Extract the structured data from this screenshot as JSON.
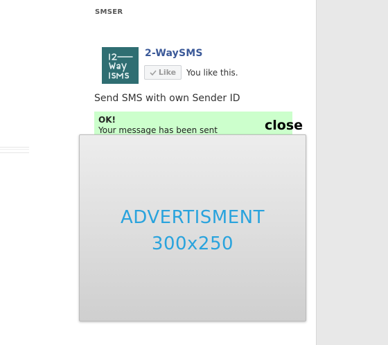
{
  "section": {
    "title": "SMSER"
  },
  "widget": {
    "app_name": "2-WaySMS",
    "logo_icon": "2-waysms-logo-icon",
    "like_button_label": "Like",
    "like_icon": "check-icon",
    "like_status": "You like this."
  },
  "main": {
    "description": "Send SMS with own Sender ID"
  },
  "alert": {
    "title": "OK!",
    "message": "Your message has been sent",
    "background_color": "#ccffcc"
  },
  "overlay": {
    "close_label": "close"
  },
  "ad": {
    "label": "ADVERTISMENT",
    "size": "300x250",
    "text_color": "#29a3dd"
  },
  "colors": {
    "link": "#3b5998",
    "logo_bg": "#2f6e72",
    "side_panel": "#e8e8e8"
  }
}
